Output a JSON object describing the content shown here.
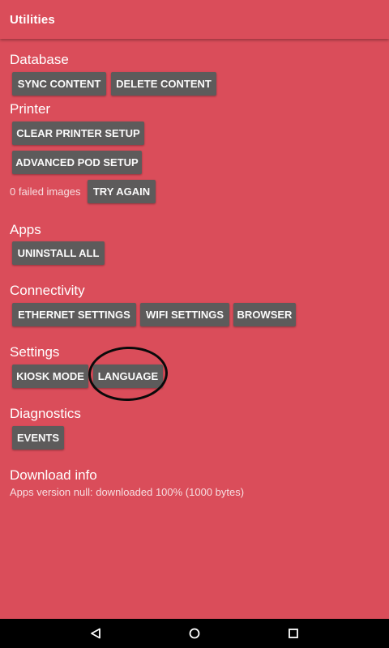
{
  "app_bar": {
    "title": "Utilities"
  },
  "database": {
    "title": "Database",
    "sync_label": "SYNC CONTENT",
    "delete_label": "DELETE CONTENT"
  },
  "printer": {
    "title": "Printer",
    "clear_label": "CLEAR PRINTER SETUP",
    "advanced_label": "ADVANCED POD SETUP",
    "failed_text": "0 failed images",
    "try_again_label": "TRY AGAIN"
  },
  "apps": {
    "title": "Apps",
    "uninstall_label": "UNINSTALL ALL"
  },
  "connectivity": {
    "title": "Connectivity",
    "ethernet_label": "ETHERNET SETTINGS",
    "wifi_label": "WIFI SETTINGS",
    "browser_label": "BROWSER"
  },
  "settings": {
    "title": "Settings",
    "kiosk_label": "KIOSK MODE",
    "language_label": "LANGUAGE"
  },
  "diagnostics": {
    "title": "Diagnostics",
    "events_label": "EVENTS"
  },
  "download": {
    "title": "Download info",
    "status_text": "Apps version null: downloaded 100% (1000 bytes)"
  },
  "nav": {
    "back_icon": "back-triangle",
    "home_icon": "home-circle",
    "recents_icon": "recents-square"
  },
  "colors": {
    "background": "#da4d5a",
    "button": "#5d5b5b",
    "annotation": "#0a0a0a"
  }
}
